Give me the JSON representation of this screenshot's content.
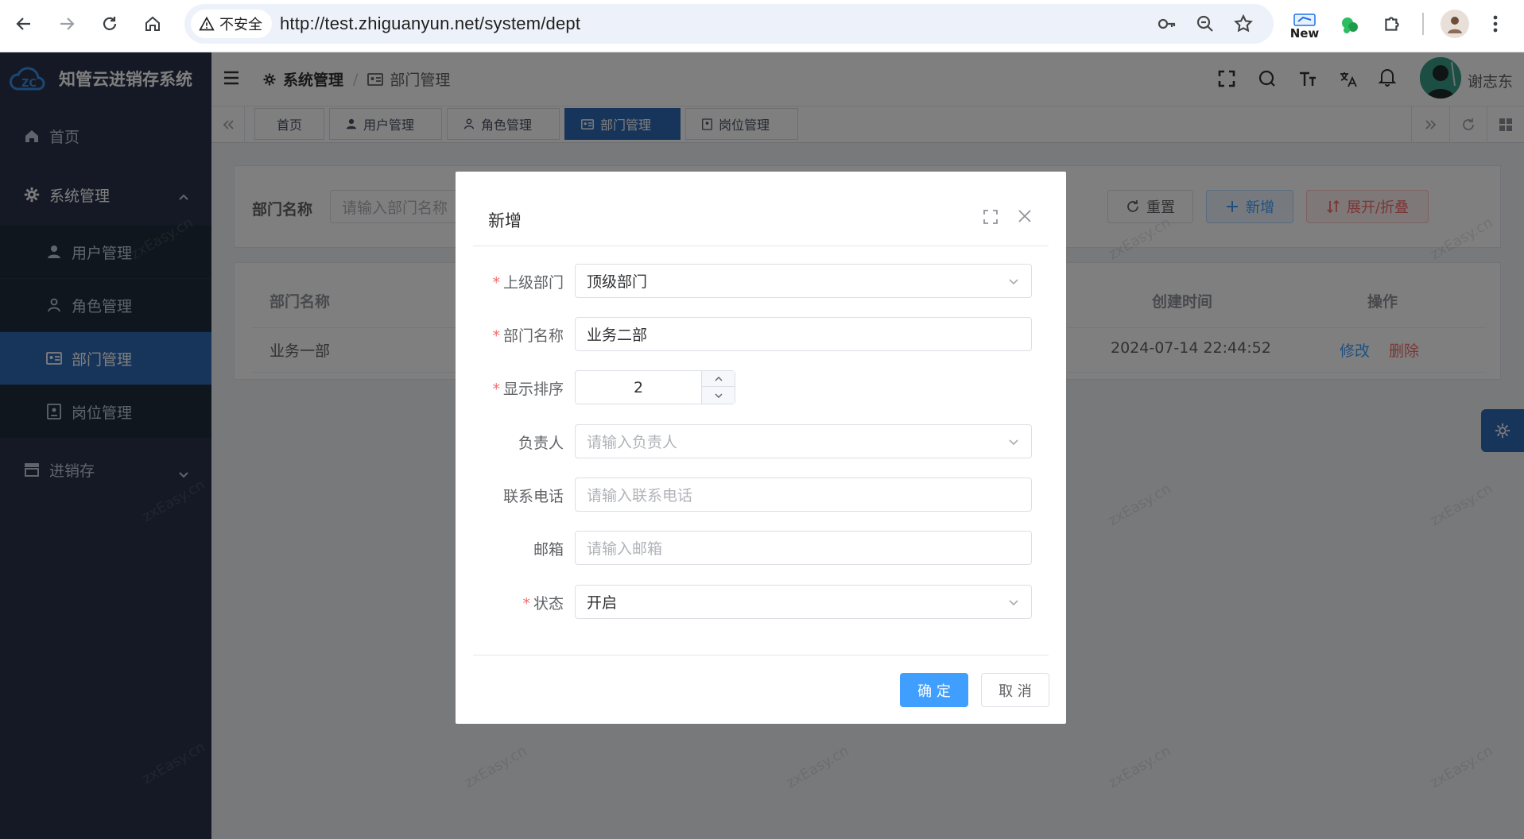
{
  "browser": {
    "security_label": "不安全",
    "url": "http://test.zhiguanyun.net/system/dept",
    "new_badge": "New"
  },
  "app": {
    "title": "知管云进销存系统",
    "user_name": "谢志东",
    "accent_color": "#2e6bb5"
  },
  "sidebar": {
    "items": [
      {
        "label": "首页"
      },
      {
        "label": "系统管理"
      },
      {
        "label": "用户管理"
      },
      {
        "label": "角色管理"
      },
      {
        "label": "部门管理"
      },
      {
        "label": "岗位管理"
      },
      {
        "label": "进销存"
      }
    ]
  },
  "breadcrumb": {
    "parent": "系统管理",
    "separator": "/",
    "current": "部门管理"
  },
  "tabs": [
    {
      "label": "首页"
    },
    {
      "label": "用户管理"
    },
    {
      "label": "角色管理"
    },
    {
      "label": "部门管理"
    },
    {
      "label": "岗位管理"
    }
  ],
  "search": {
    "label": "部门名称",
    "placeholder": "请输入部门名称",
    "reset_label": "重置",
    "add_label": "新增",
    "expand_label": "展开/折叠"
  },
  "table": {
    "headers": [
      "部门名称",
      "创建时间",
      "操作"
    ],
    "rows": [
      {
        "name": "业务一部",
        "created": "2024-07-14 22:44:52",
        "edit": "修改",
        "delete": "删除"
      }
    ]
  },
  "watermark": "zxEasy.cn",
  "dialog": {
    "title": "新增",
    "fields": {
      "parent": {
        "label": "上级部门",
        "value": "顶级部门"
      },
      "name": {
        "label": "部门名称",
        "value": "业务二部"
      },
      "sort": {
        "label": "显示排序",
        "value": "2"
      },
      "leader": {
        "label": "负责人",
        "placeholder": "请输入负责人"
      },
      "phone": {
        "label": "联系电话",
        "placeholder": "请输入联系电话"
      },
      "email": {
        "label": "邮箱",
        "placeholder": "请输入邮箱"
      },
      "status": {
        "label": "状态",
        "value": "开启"
      }
    },
    "confirm_label": "确 定",
    "cancel_label": "取 消"
  }
}
